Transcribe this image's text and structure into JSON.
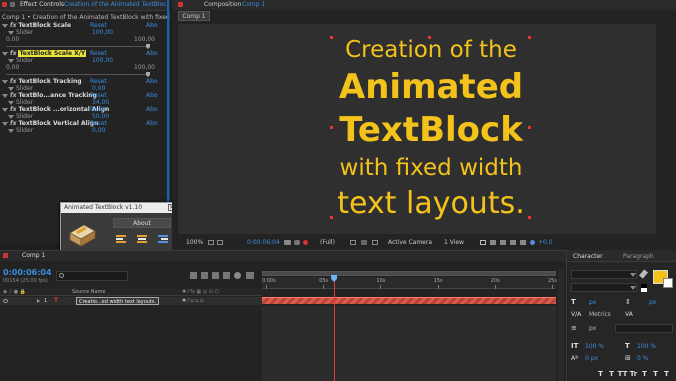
{
  "effect_controls": {
    "panel_title": "Effect Controls",
    "panel_subtitle": "Creation of the Animated TextBlock",
    "comp_path": "Comp 1 • Creation of the Animated TextBlock with fixed width",
    "effects": [
      {
        "name": "TextBlock  Scale",
        "reset": "Reset",
        "about": "Abo",
        "slider_label": "Slider",
        "value": "100,00",
        "min": "0,00",
        "max": "100,00",
        "expanded": true,
        "level": 1.0
      },
      {
        "name": "TextBlock  Scale X/Y",
        "reset": "Reset",
        "about": "Abo",
        "slider_label": "Slider",
        "value": "100,00",
        "min": "0,00",
        "max": "100,00",
        "expanded": true,
        "highlighted": true,
        "level": 1.0
      },
      {
        "name": "TextBlock  Tracking",
        "reset": "Reset",
        "about": "Abo",
        "slider_label": "Slider",
        "value": "0,00",
        "expanded": true
      },
      {
        "name": "TextBlo...ance Tracking",
        "reset": "Reset",
        "about": "Abo",
        "slider_label": "Slider",
        "value": "34,00",
        "expanded": true
      },
      {
        "name": "TextBlock ...orizontal Align",
        "reset": "Reset",
        "about": "Abo",
        "slider_label": "Slider",
        "value": "50,00",
        "expanded": true
      },
      {
        "name": "TextBlock  Vertical Align",
        "reset": "Reset",
        "about": "Abo",
        "slider_label": "Slider",
        "value": "0,00",
        "expanded": true
      }
    ]
  },
  "plugin_window": {
    "title": "Animated TextBlock v1.10",
    "about_label": "About",
    "align_buttons": [
      "align-left-icon",
      "align-center-icon",
      "align-right-icon"
    ]
  },
  "composition": {
    "panel_label": "Composition",
    "panel_name": "Comp 1",
    "tab_label": "Comp 1",
    "text_lines": [
      "Creation of the",
      "Animated",
      "TextBlock",
      "with fixed width",
      "text layouts."
    ],
    "text_color": "#f3c21b",
    "footer": {
      "zoom": "100%",
      "timecode": "0:00:06:04",
      "resolution": "(Full)",
      "camera": "Active Camera",
      "view": "1 View",
      "exposure": "+0,0"
    }
  },
  "timeline": {
    "tab_label": "Comp 1",
    "timecode": "0:00:06:04",
    "frames": "00154 (25.00 fps)",
    "source_name_header": "Source Name",
    "layer_number": "1",
    "layer_name": "Creatio...ed width text layouts.",
    "ruler_labels": [
      "0:00s",
      "05s",
      "10s",
      "15s",
      "20s",
      "25s"
    ],
    "current_time_fraction": 0.245
  },
  "character": {
    "tab_character": "Character",
    "tab_paragraph": "Paragraph",
    "fill_color": "#f3c21b",
    "font_size": "px",
    "leading": "px",
    "kerning": "Metrics",
    "tracking": "",
    "stroke_width": "px",
    "vscale": "100 %",
    "hscale": "100 %",
    "baseline": "0 px",
    "tsume": "0 %",
    "style_buttons": [
      "T",
      "T",
      "TT",
      "Tr",
      "T",
      "T",
      "T"
    ]
  }
}
